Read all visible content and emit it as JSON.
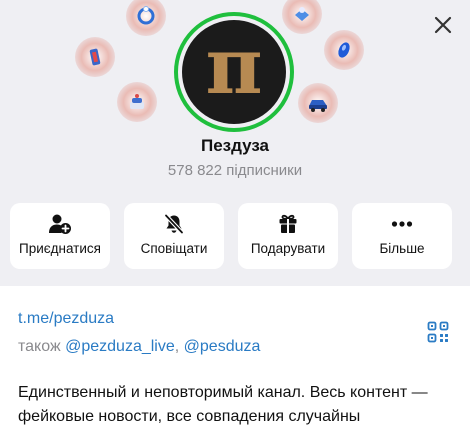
{
  "header": {
    "close_icon": "close-icon",
    "avatar_letter": "п",
    "channel_name": "Пездуза",
    "subscribers": "578 822 підписники",
    "ring_color": "#1fbf3d",
    "gifts": [
      "gift-ring-icon",
      "gift-stick-icon",
      "gift-book-icon",
      "gift-gem-icon",
      "gift-cake-icon",
      "gift-car-icon"
    ]
  },
  "actions": [
    {
      "label": "Приєднатися",
      "icon": "join-user-plus-icon"
    },
    {
      "label": "Сповіщати",
      "icon": "bell-muted-icon"
    },
    {
      "label": "Подарувати",
      "icon": "gift-icon"
    },
    {
      "label": "Більше",
      "icon": "more-dots-icon"
    }
  ],
  "info": {
    "link": "t.me/pezduza",
    "also_prefix": "також",
    "also_link_1": "@pezduza_live",
    "separator": ",",
    "also_link_2": "@pesduza",
    "qr_icon": "qr-code-icon",
    "description": "Единственный и неповторимый канал. Весь контент — фейковые новости, все совпадения случайны"
  },
  "colors": {
    "header_bg": "#efeff3",
    "link": "#2a7bc4",
    "muted_text": "#8a8a8e"
  }
}
